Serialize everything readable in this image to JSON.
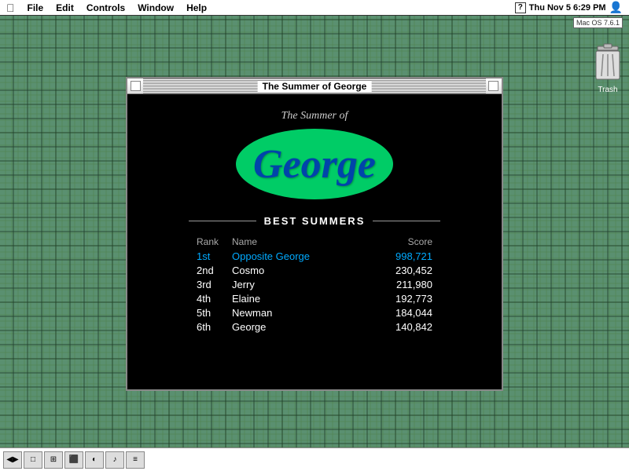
{
  "menubar": {
    "apple_symbol": "🍎",
    "items": [
      "File",
      "Edit",
      "Controls",
      "Window",
      "Help"
    ],
    "clock": "Thu Nov 5 6:29 PM",
    "help_icon": "?"
  },
  "os_badge": {
    "label": "Mac OS 7.6.1"
  },
  "trash": {
    "label": "Trash"
  },
  "window": {
    "title": "The Summer of George",
    "subtitle": "The Summer of",
    "george_text": "George",
    "best_summers_label": "BEST SUMMERS",
    "table": {
      "headers": {
        "rank": "Rank",
        "name": "Name",
        "score": "Score"
      },
      "rows": [
        {
          "rank": "1st",
          "name": "Opposite George",
          "score": "998,721",
          "highlight": true
        },
        {
          "rank": "2nd",
          "name": "Cosmo",
          "score": "230,452",
          "highlight": false
        },
        {
          "rank": "3rd",
          "name": "Jerry",
          "score": "211,980",
          "highlight": false
        },
        {
          "rank": "4th",
          "name": "Elaine",
          "score": "192,773",
          "highlight": false
        },
        {
          "rank": "5th",
          "name": "Newman",
          "score": "184,044",
          "highlight": false
        },
        {
          "rank": "6th",
          "name": "George",
          "score": "140,842",
          "highlight": false
        }
      ]
    }
  },
  "taskbar": {
    "buttons": [
      "◀▶",
      "□",
      "⊞",
      "⬛",
      "◐",
      "♪",
      "≡"
    ]
  }
}
